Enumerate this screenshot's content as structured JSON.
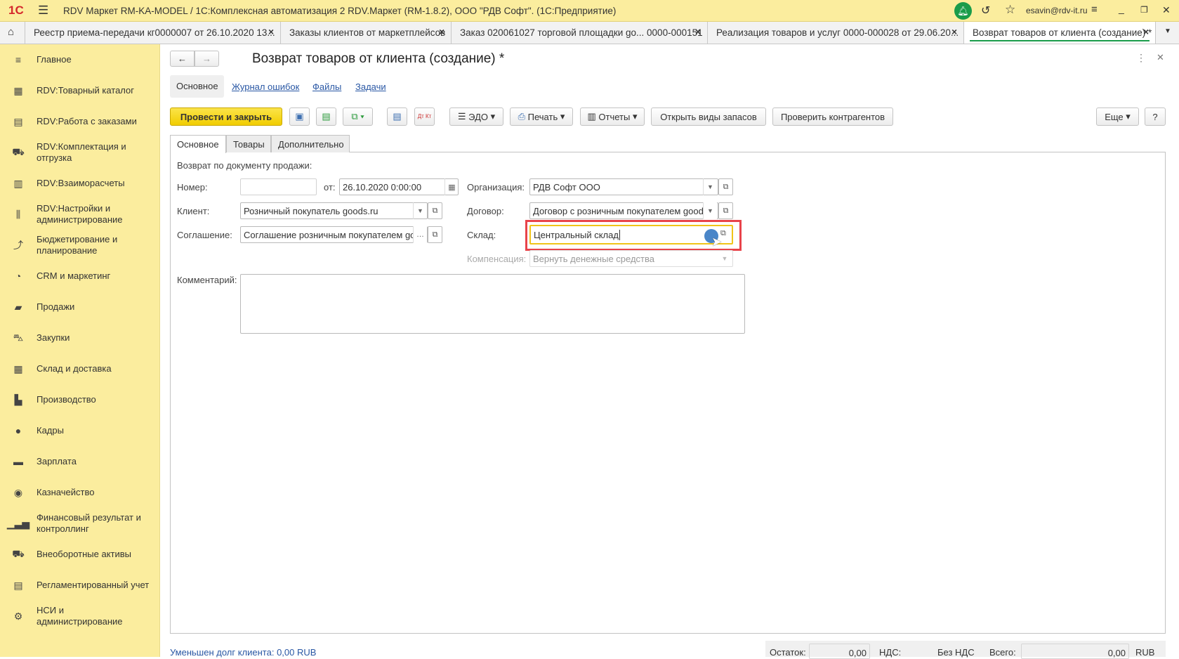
{
  "titlebar": {
    "logo": "1С",
    "title": "RDV Маркет RM-KA-MODEL / 1С:Комплексная автоматизация 2 RDV.Маркет (RM-1.8.2), ООО \"РДВ Софт\".  (1С:Предприятие)",
    "user": "esavin@rdv-it.ru"
  },
  "window_tabs": [
    {
      "label": "Реестр приема-передачи кг0000007 от 26.10.2020 13..."
    },
    {
      "label": "Заказы клиентов от маркетплейсов"
    },
    {
      "label": "Заказ 020061027 торговой площадки go... 0000-000151"
    },
    {
      "label": "Реализация товаров и услуг 0000-000028 от 29.06.20..."
    },
    {
      "label": "Возврат товаров от клиента (создание) *"
    }
  ],
  "sidebar": {
    "items": [
      {
        "label": "Главное",
        "icon": "menu-icon"
      },
      {
        "label": "RDV:Товарный каталог",
        "icon": "grid-icon"
      },
      {
        "label": "RDV:Работа с заказами",
        "icon": "document-icon"
      },
      {
        "label": "RDV:Комплектация и отгрузка",
        "icon": "cart-icon"
      },
      {
        "label": "RDV:Взаиморасчеты",
        "icon": "calculator-icon"
      },
      {
        "label": "RDV:Настройки и администрирование",
        "icon": "sliders-icon"
      },
      {
        "label": "Бюджетирование и планирование",
        "icon": "chart-icon"
      },
      {
        "label": "CRM и маркетинг",
        "icon": "pie-icon"
      },
      {
        "label": "Продажи",
        "icon": "bag-icon"
      },
      {
        "label": "Закупки",
        "icon": "basket-icon"
      },
      {
        "label": "Склад и доставка",
        "icon": "warehouse-icon"
      },
      {
        "label": "Производство",
        "icon": "factory-icon"
      },
      {
        "label": "Кадры",
        "icon": "person-icon"
      },
      {
        "label": "Зарплата",
        "icon": "wallet-icon"
      },
      {
        "label": "Казначейство",
        "icon": "coin-icon"
      },
      {
        "label": "Финансовый результат и контроллинг",
        "icon": "bar-chart-icon"
      },
      {
        "label": "Внеоборотные активы",
        "icon": "truck-icon"
      },
      {
        "label": "Регламентированный учет",
        "icon": "ledger-icon"
      },
      {
        "label": "НСИ и администрирование",
        "icon": "gear-icon"
      }
    ]
  },
  "form": {
    "title": "Возврат товаров от клиента (создание) *",
    "nav": {
      "main": "Основное",
      "errors": "Журнал ошибок",
      "files": "Файлы",
      "tasks": "Задачи"
    },
    "toolbar": {
      "post_close": "Провести и закрыть",
      "edo": "ЭДО",
      "print": "Печать",
      "reports": "Отчеты",
      "open_stock_types": "Открыть виды запасов",
      "check_counterparties": "Проверить контрагентов",
      "more": "Еще",
      "help": "?",
      "dtkt": "Дт Кт"
    },
    "tabs": [
      "Основное",
      "Товары",
      "Дополнительно"
    ],
    "section": "Возврат по документу продажи:",
    "fields": {
      "number_label": "Номер:",
      "number_value": "",
      "date_label": "от:",
      "date_value": "26.10.2020  0:00:00",
      "org_label": "Организация:",
      "org_value": "РДВ Софт ООО",
      "client_label": "Клиент:",
      "client_value": "Розничный покупатель goods.ru",
      "contract_label": "Договор:",
      "contract_value": "Договор с розничным покупателем goods",
      "agreement_label": "Соглашение:",
      "agreement_value": "Соглашение розничным покупателем goods",
      "warehouse_label": "Склад:",
      "warehouse_value": "Центральный склад",
      "compensation_label": "Компенсация:",
      "compensation_value": "Вернуть денежные средства",
      "comment_label": "Комментарий:",
      "comment_value": ""
    },
    "footer": {
      "debt": "Уменьшен долг клиента: 0,00 RUB",
      "rest_label": "Остаток:",
      "rest_value": "0,00",
      "vat_label": "НДС:",
      "vat_value": "Без НДС",
      "total_label": "Всего:",
      "total_value": "0,00",
      "currency": "RUB"
    }
  }
}
